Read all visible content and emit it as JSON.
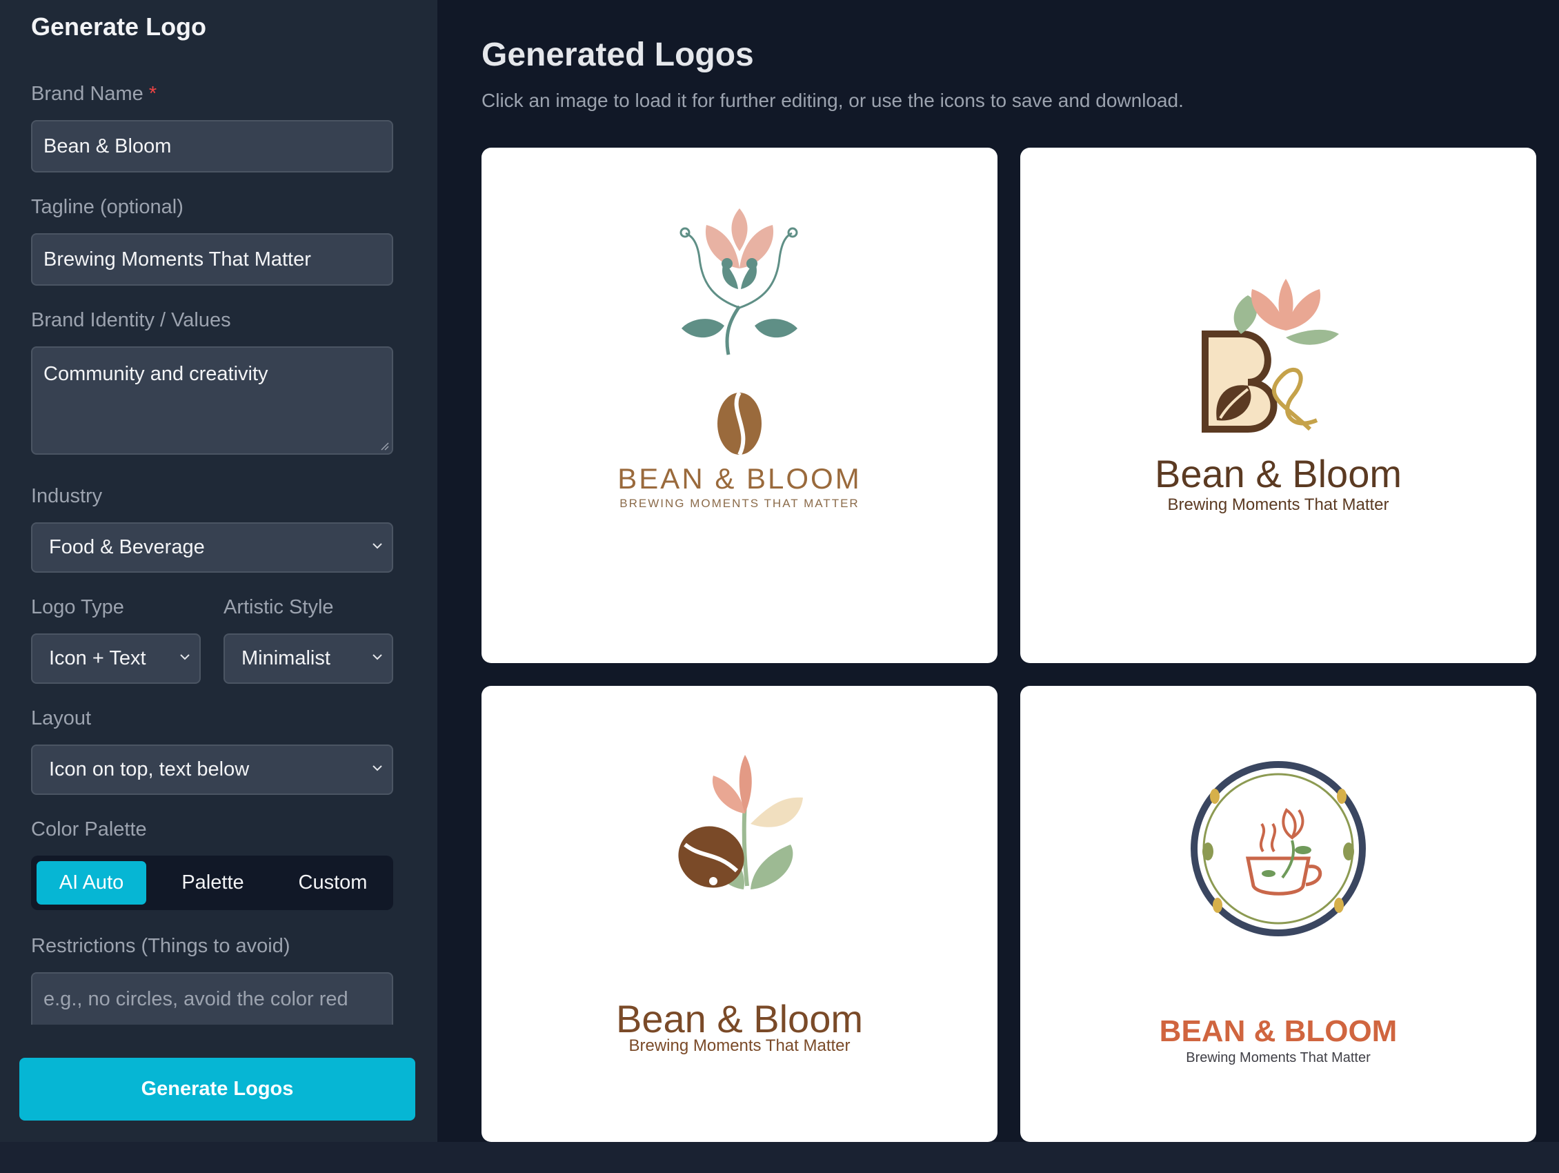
{
  "sidebar": {
    "title": "Generate Logo",
    "brand_name": {
      "label": "Brand Name",
      "required_mark": "*",
      "value": "Bean & Bloom"
    },
    "tagline": {
      "label": "Tagline (optional)",
      "value": "Brewing Moments That Matter"
    },
    "identity": {
      "label": "Brand Identity / Values",
      "value": "Community and creativity"
    },
    "industry": {
      "label": "Industry",
      "value": "Food & Beverage"
    },
    "logo_type": {
      "label": "Logo Type",
      "value": "Icon + Text"
    },
    "artistic_style": {
      "label": "Artistic Style",
      "value": "Minimalist"
    },
    "layout": {
      "label": "Layout",
      "value": "Icon on top, text below"
    },
    "palette": {
      "label": "Color Palette",
      "options": [
        "AI Auto",
        "Palette",
        "Custom"
      ],
      "selected": "AI Auto"
    },
    "restrictions": {
      "label": "Restrictions (Things to avoid)",
      "placeholder": "e.g., no circles, avoid the color red"
    },
    "generate_label": "Generate Logos"
  },
  "main": {
    "title": "Generated Logos",
    "subtitle": "Click an image to load it for further editing, or use the icons to save and download.",
    "logos": [
      {
        "name": "BEAN & BLOOM",
        "tagline": "BREWING MOMENTS THAT MATTER",
        "name_color": "#9a6a3c",
        "tagline_color": "#8b6b4a"
      },
      {
        "name": "Bean & Bloom",
        "tagline": "Brewing Moments That Matter",
        "name_color": "#5b3a22",
        "tagline_color": "#5b3a22"
      },
      {
        "name": "Bean & Bloom",
        "tagline": "Brewing Moments That Matter",
        "name_color": "#7a4a28",
        "tagline_color": "#7a4a28"
      },
      {
        "name": "BEAN & BLOOM",
        "tagline": "Brewing Moments That Matter",
        "name_color": "#d0653f",
        "tagline_color": "#3f3f46"
      }
    ]
  },
  "colors": {
    "accent": "#06b6d4",
    "sidebar_bg": "#1f2937",
    "main_bg": "#111827",
    "required": "#ef4444"
  },
  "icons": [
    "chevron-down-icon",
    "resize-grip-icon",
    "lotus-bean-icon",
    "monogram-b-icon",
    "tulip-bean-icon",
    "coffee-cup-wreath-icon"
  ]
}
